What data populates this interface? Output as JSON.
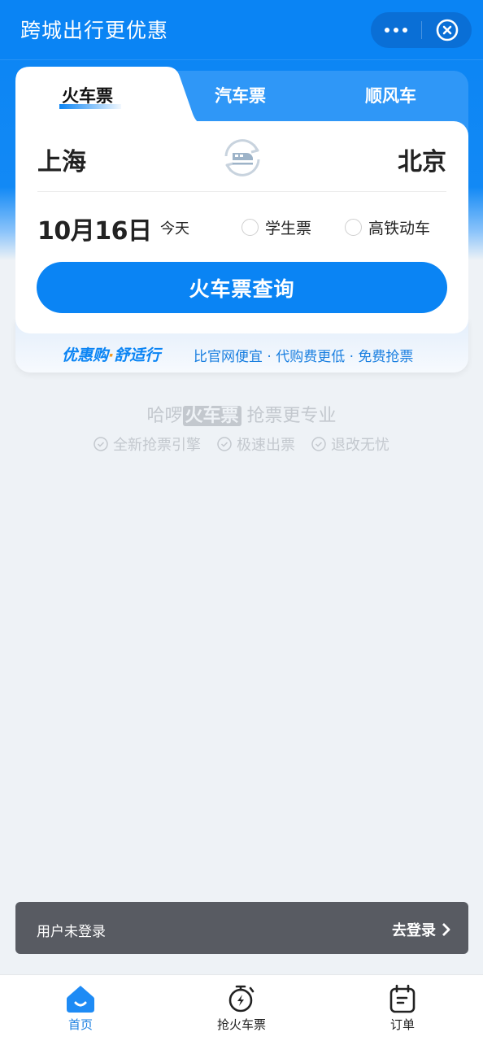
{
  "nav": {
    "title": "跨城出行更优惠",
    "more_icon": "more-dots-icon",
    "close_icon": "close-circle-icon"
  },
  "tabs": [
    {
      "label": "火车票",
      "active": true
    },
    {
      "label": "汽车票",
      "active": false
    },
    {
      "label": "顺风车",
      "active": false
    }
  ],
  "search": {
    "from_city": "上海",
    "to_city": "北京",
    "swap_icon": "train-swap-icon",
    "date": "10月16日",
    "date_note": "今天",
    "options": [
      {
        "label": "学生票",
        "checked": false
      },
      {
        "label": "高铁动车",
        "checked": false
      }
    ],
    "button_label": "火车票查询"
  },
  "promo": {
    "title_part1": "优惠购",
    "dot": "·",
    "title_part2": "舒适行",
    "description": "比官网便宜 · 代购费更低 · 免费抢票"
  },
  "slogan": {
    "prefix": "哈啰",
    "tag": "火车票",
    "suffix": " 抢票更专业"
  },
  "features": [
    {
      "label": "全新抢票引擎",
      "icon": "check-circle-icon"
    },
    {
      "label": "极速出票",
      "icon": "check-circle-icon"
    },
    {
      "label": "退改无忧",
      "icon": "check-circle-icon"
    }
  ],
  "login_bar": {
    "status": "用户未登录",
    "action": "去登录"
  },
  "tabbar": [
    {
      "label": "首页",
      "icon": "home-icon",
      "active": true
    },
    {
      "label": "抢火车票",
      "icon": "stopwatch-bolt-icon",
      "active": false
    },
    {
      "label": "订单",
      "icon": "calendar-order-icon",
      "active": false
    }
  ],
  "colors": {
    "primary": "#0a84f4",
    "accent_dot": "#f59a23",
    "login_bar": "#585b62",
    "page_bg": "#eef2f6"
  }
}
